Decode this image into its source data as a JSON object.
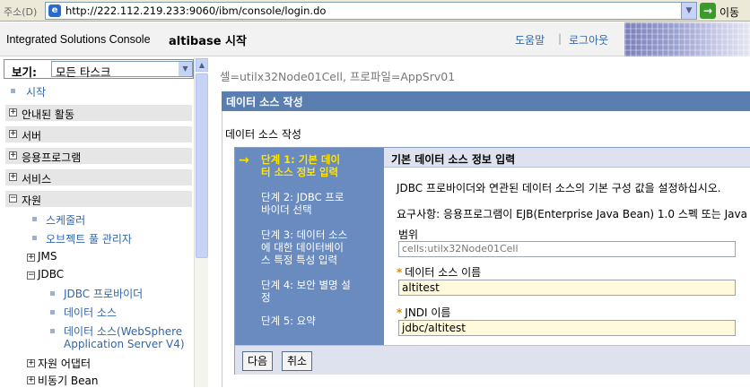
{
  "browser": {
    "address_label": "주소(D)",
    "url": "http://222.112.219.233:9060/ibm/console/login.do",
    "go_label": "이동"
  },
  "header": {
    "brand": "Integrated Solutions Console",
    "welcome": "altibase 시작",
    "help": "도움말",
    "separator": "|",
    "logout": "로그아웃"
  },
  "nav": {
    "view_label": "보기:",
    "view_value": "모든 타스크",
    "start": "시작",
    "sections": [
      {
        "label": "안내된 활동"
      },
      {
        "label": "서버"
      },
      {
        "label": "응용프로그램"
      },
      {
        "label": "서비스"
      },
      {
        "label": "자원"
      }
    ],
    "resources": {
      "scheduler": "스케줄러",
      "object_pool": "오브젝트 풀 관리자",
      "jms": "JMS",
      "jdbc": "JDBC",
      "jdbc_provider": "JDBC 프로바이더",
      "data_source": "데이터 소스",
      "data_source_v4_line1": "데이터 소스(WebSphere",
      "data_source_v4_line2": "Application Server V4)",
      "resource_adapter": "자원 어댑터",
      "async_bean": "비동기 Bean"
    }
  },
  "main": {
    "scope": "셀=utilx32Node01Cell, 프로파일=AppSrv01",
    "title": "데이터 소스 작성",
    "subtitle": "데이터 소스 작성",
    "steps": [
      {
        "line1": "단계 1: 기본 데이",
        "line2": "터 소스 정보 입력"
      },
      {
        "line1": "단계 2: JDBC 프로",
        "line2": "바이더 선택"
      },
      {
        "line1": "단계 3: 데이터 소스",
        "line2": "에 대한 데이터베이",
        "line3": "스 특정 특성 입력"
      },
      {
        "line1": "단계 4: 보안 별명 설",
        "line2": "정"
      },
      {
        "line1": "단계 5: 요약"
      }
    ],
    "step_arrow": "→",
    "content_title": "기본 데이터 소스 정보 입력",
    "desc1": "JDBC 프로바이더와 연관된 데이터 소스의 기본 구성 값을 설정하십시오.",
    "desc2": "요구사항: 응용프로그램이 EJB(Enterprise Java Bean) 1.0 스펙 또는 Java",
    "scope_label": "범위",
    "scope_value": "cells:utilx32Node01Cell",
    "required_mark": "*",
    "ds_name_label": "데이터 소스 이름",
    "ds_name_value": "altitest",
    "jndi_label": "JNDI 이름",
    "jndi_value": "jdbc/altitest",
    "next_button": "다음",
    "cancel_button": "취소"
  }
}
